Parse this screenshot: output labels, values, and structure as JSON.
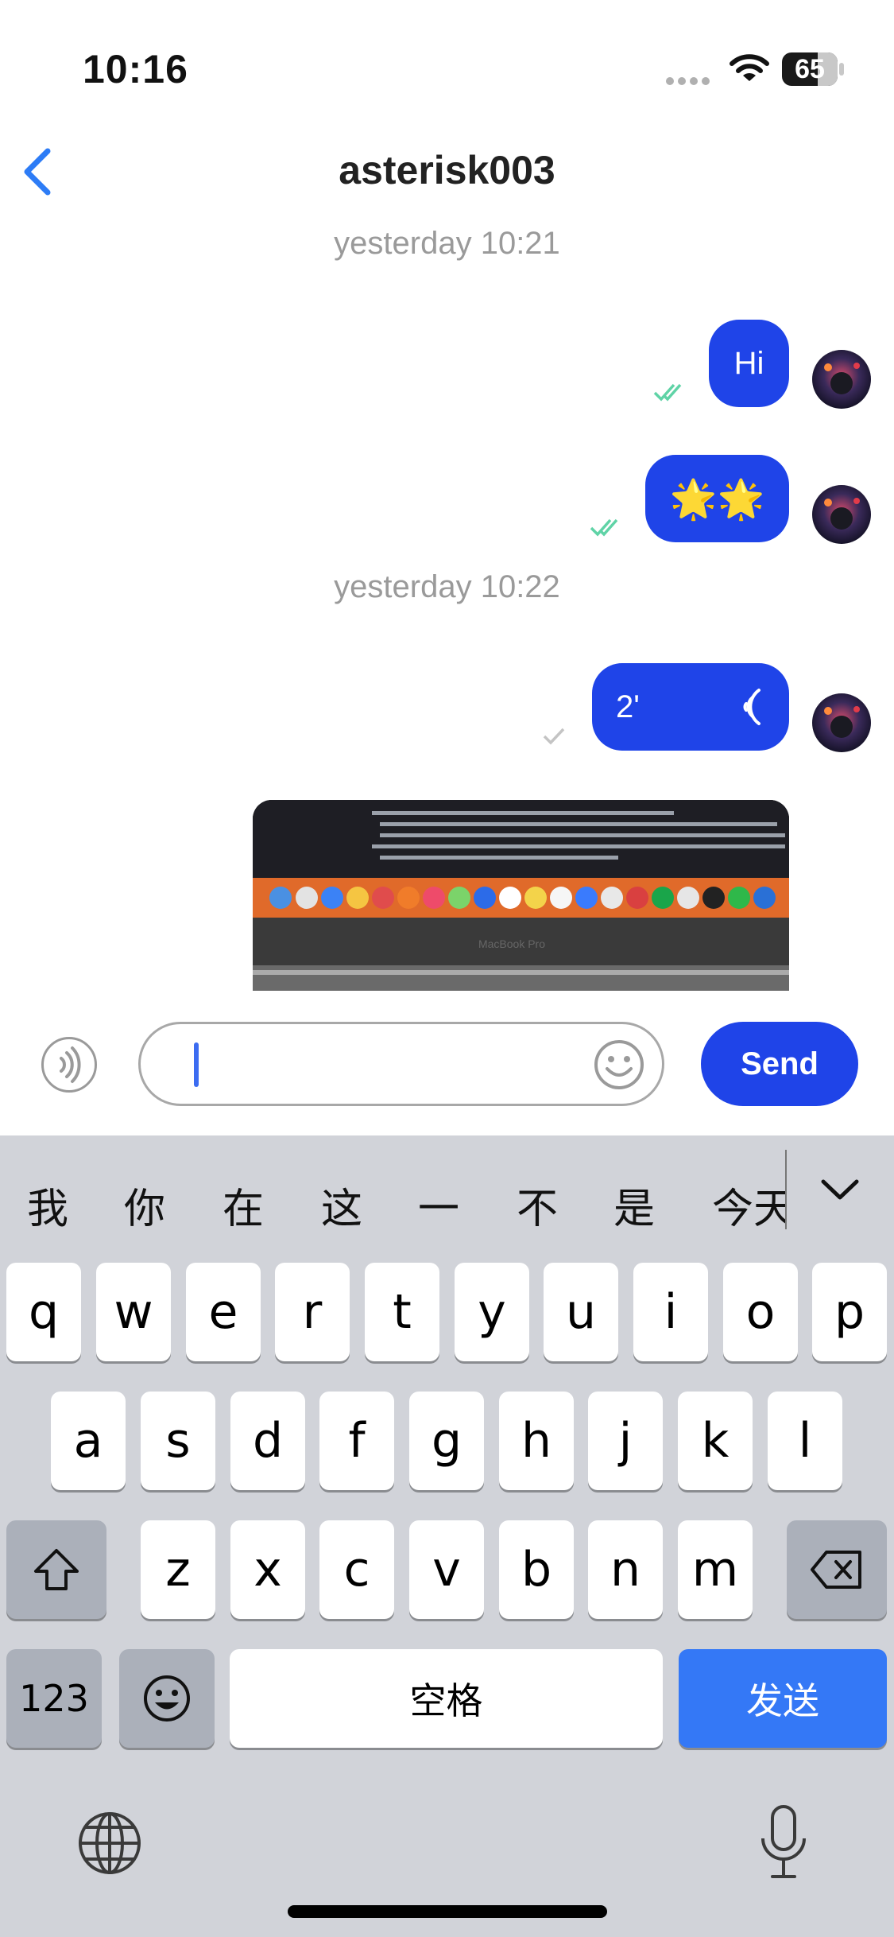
{
  "status_bar": {
    "time": "10:16",
    "battery": "65"
  },
  "nav": {
    "title": "asterisk003"
  },
  "messages": [
    {
      "type": "timestamp",
      "text": "yesterday 10:21"
    },
    {
      "type": "text",
      "text": "Hi",
      "read": true
    },
    {
      "type": "text",
      "text": "🌟🌟",
      "read": true
    },
    {
      "type": "timestamp",
      "text": "yesterday 10:22"
    },
    {
      "type": "voice",
      "duration": "2'",
      "read": false
    },
    {
      "type": "image",
      "caption": "MacBook Pro"
    }
  ],
  "input": {
    "value": "",
    "send_label": "Send"
  },
  "keyboard": {
    "candidates": [
      "我",
      "你",
      "在",
      "这",
      "一",
      "不",
      "是",
      "今天"
    ],
    "row1": [
      "q",
      "w",
      "e",
      "r",
      "t",
      "y",
      "u",
      "i",
      "o",
      "p"
    ],
    "row2": [
      "a",
      "s",
      "d",
      "f",
      "g",
      "h",
      "j",
      "k",
      "l"
    ],
    "row3": [
      "z",
      "x",
      "c",
      "v",
      "b",
      "n",
      "m"
    ],
    "numbers_label": "123",
    "space_label": "空格",
    "send_label": "发送"
  },
  "colors": {
    "accent": "#1f44e8",
    "keyboard_send": "#3478f6",
    "read_tick": "#5fd3a6"
  }
}
